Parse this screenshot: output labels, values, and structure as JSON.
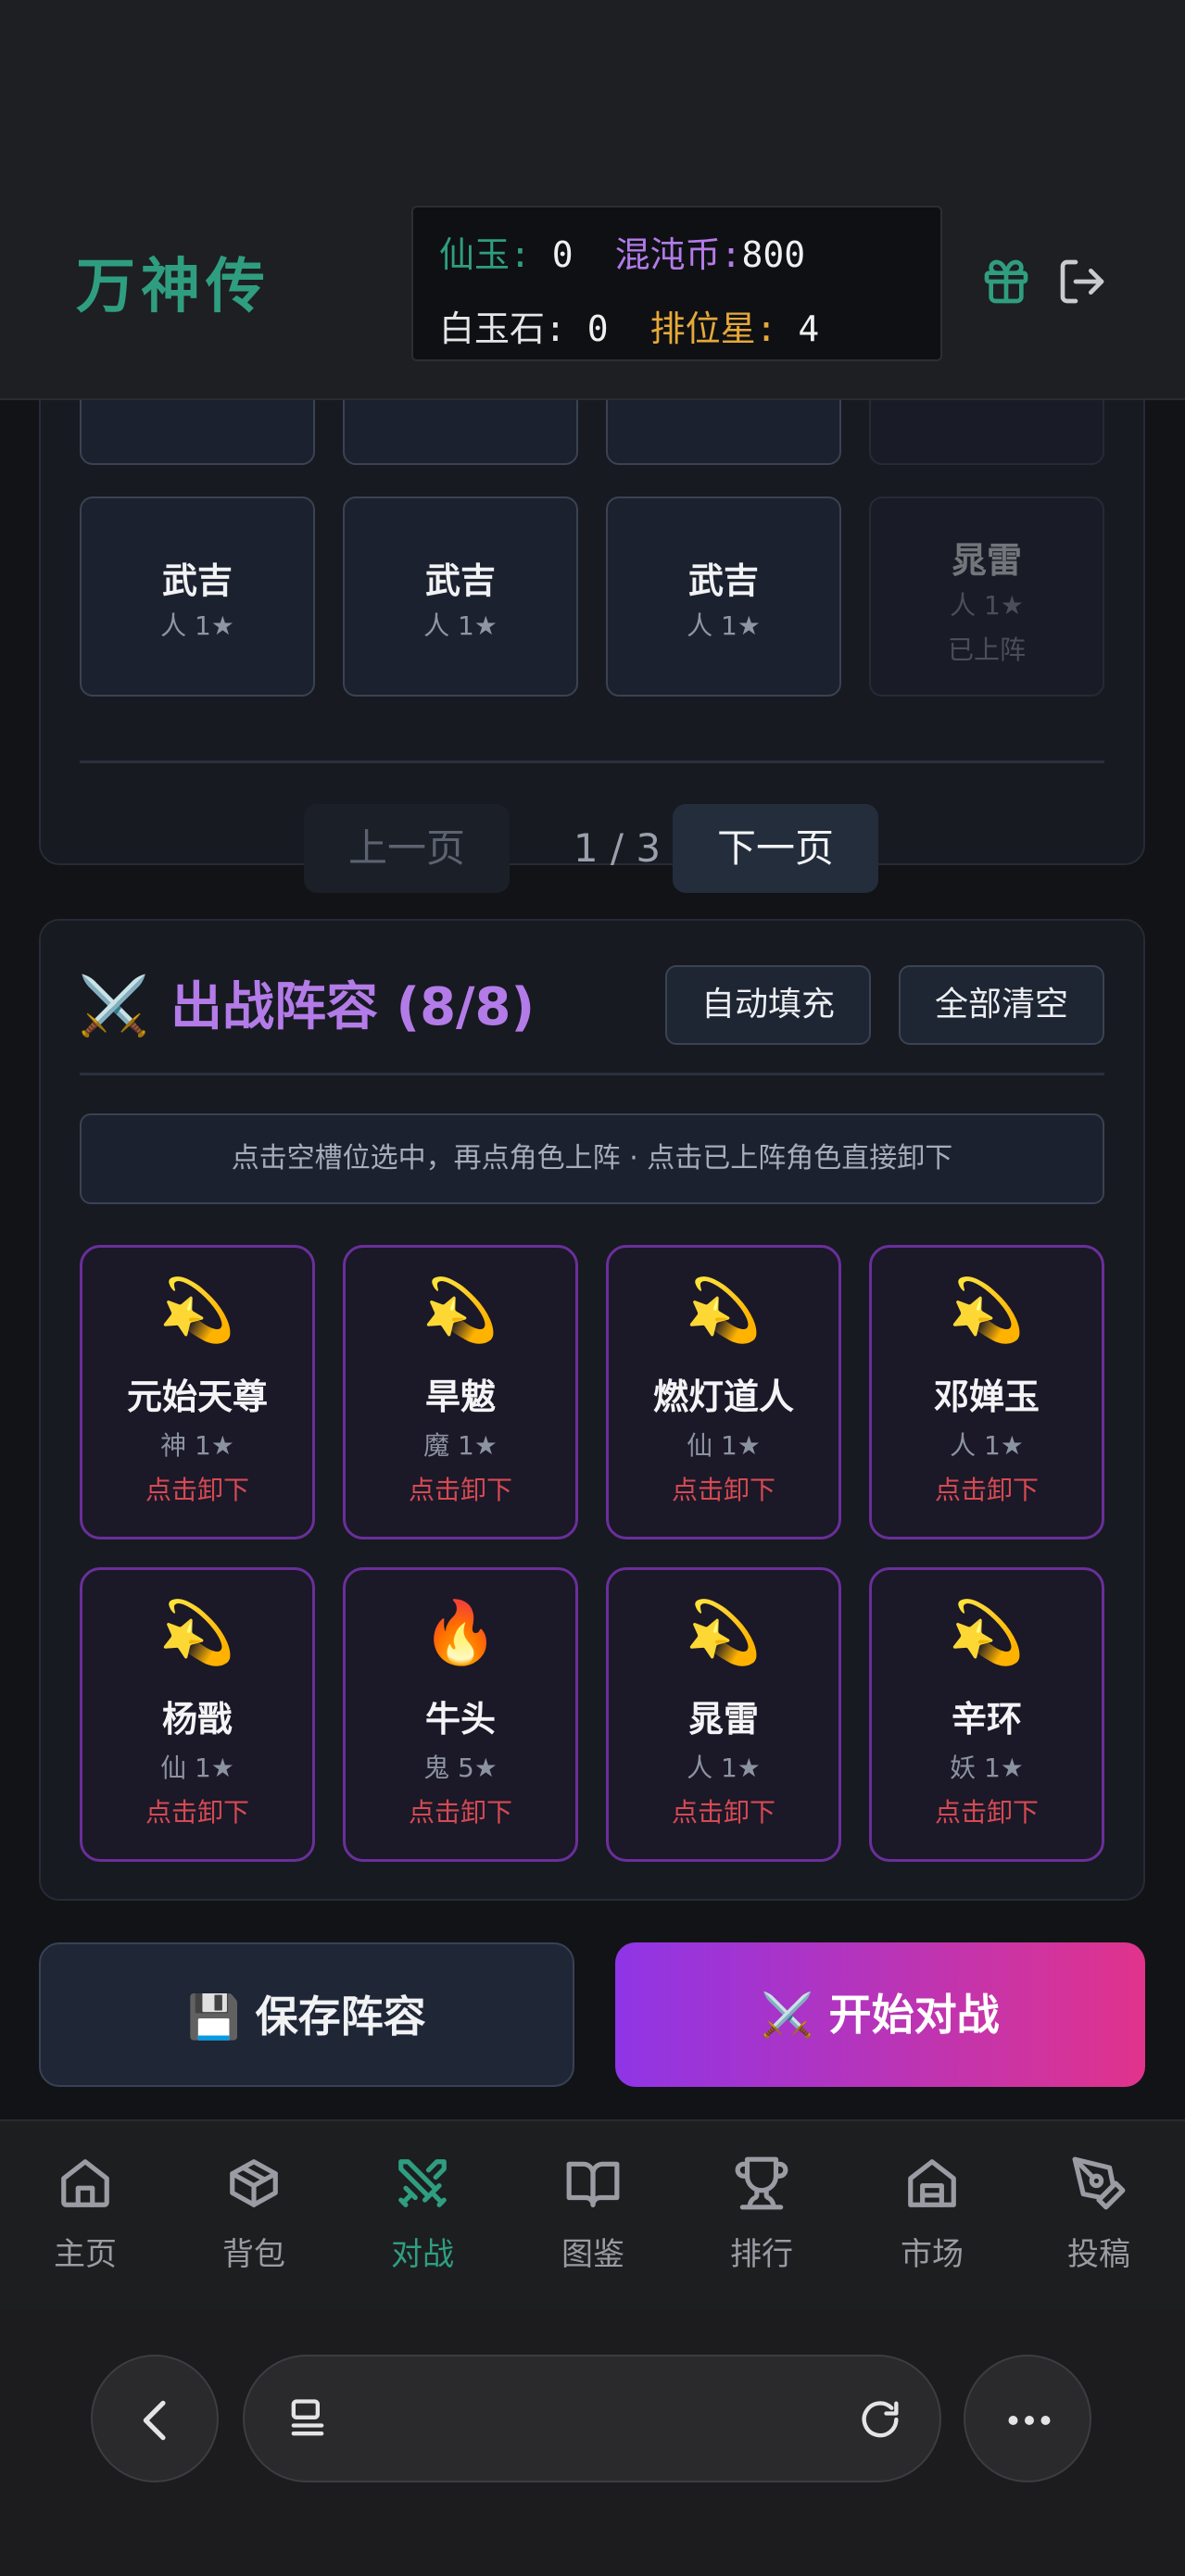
{
  "app": {
    "title": "万神传"
  },
  "currency": {
    "xianyu_label": "仙玉:",
    "xianyu_value": "0",
    "hundun_label": "混沌币:",
    "hundun_value": "800",
    "baiyu_label": "白玉石:",
    "baiyu_value": "0",
    "paiwei_label": "排位星:",
    "paiwei_value": "4",
    "colors": {
      "xianyu": "#2f9e80",
      "hundun": "#b37be8",
      "baiyu": "#e6e6e6",
      "paiwei": "#e5a93a"
    }
  },
  "topbar": {
    "icons": [
      "gift-icon",
      "logout-icon"
    ]
  },
  "roster": {
    "cells": [
      {
        "name": "武吉",
        "sub": "人 1★",
        "status": ""
      },
      {
        "name": "武吉",
        "sub": "人 1★",
        "status": ""
      },
      {
        "name": "武吉",
        "sub": "人 1★",
        "status": ""
      },
      {
        "name": "晁雷",
        "sub": "人 1★",
        "status": "已上阵"
      }
    ],
    "pager": {
      "prev": "上一页",
      "page": "1 / 3",
      "next": "下一页"
    }
  },
  "lineup": {
    "icon": "⚔️",
    "title": "出战阵容 (8/8)",
    "auto_fill": "自动填充",
    "clear_all": "全部清空",
    "hint": "点击空槽位选中，再点角色上阵 · 点击已上阵角色直接卸下",
    "slots": [
      {
        "emoji": "💫",
        "name": "元始天尊",
        "sub": "神 1★",
        "action": "点击卸下"
      },
      {
        "emoji": "💫",
        "name": "旱魃",
        "sub": "魔 1★",
        "action": "点击卸下"
      },
      {
        "emoji": "💫",
        "name": "燃灯道人",
        "sub": "仙 1★",
        "action": "点击卸下"
      },
      {
        "emoji": "💫",
        "name": "邓婵玉",
        "sub": "人 1★",
        "action": "点击卸下"
      },
      {
        "emoji": "💫",
        "name": "杨戬",
        "sub": "仙 1★",
        "action": "点击卸下"
      },
      {
        "emoji": "🔥",
        "name": "牛头",
        "sub": "鬼 5★",
        "action": "点击卸下"
      },
      {
        "emoji": "💫",
        "name": "晁雷",
        "sub": "人 1★",
        "action": "点击卸下"
      },
      {
        "emoji": "💫",
        "name": "辛环",
        "sub": "妖 1★",
        "action": "点击卸下"
      }
    ]
  },
  "actions": {
    "save_icon": "💾",
    "save": "保存阵容",
    "battle_icon": "⚔️",
    "battle": "开始对战"
  },
  "nav": {
    "items": [
      {
        "label": "主页",
        "icon": "home-icon"
      },
      {
        "label": "背包",
        "icon": "box-icon"
      },
      {
        "label": "对战",
        "icon": "swords-icon",
        "active": true
      },
      {
        "label": "图鉴",
        "icon": "book-icon"
      },
      {
        "label": "排行",
        "icon": "trophy-icon"
      },
      {
        "label": "市场",
        "icon": "store-icon"
      },
      {
        "label": "投稿",
        "icon": "pen-icon"
      }
    ]
  },
  "browser": {
    "icons": [
      "back-icon",
      "tabs-icon",
      "reload-icon",
      "more-icon"
    ]
  }
}
